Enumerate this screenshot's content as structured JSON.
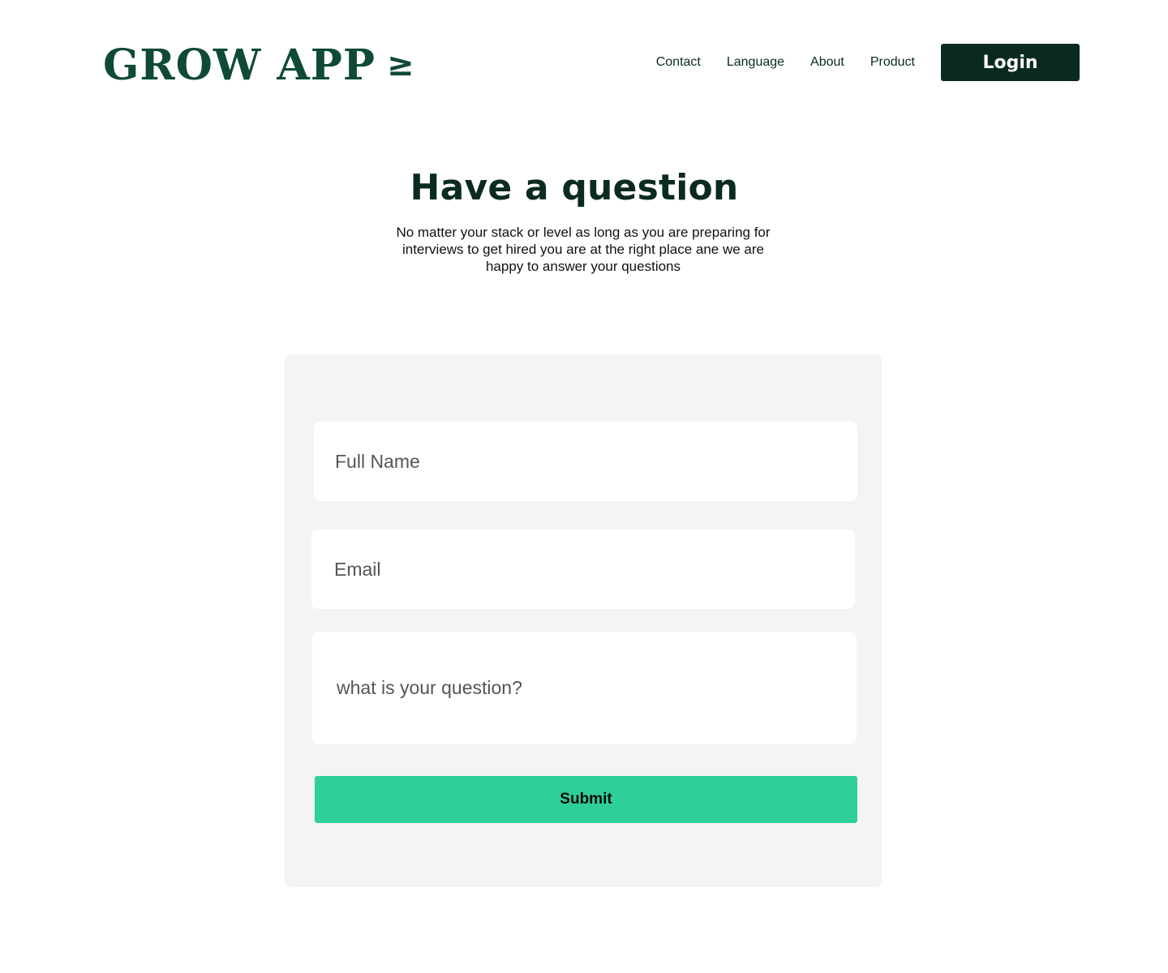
{
  "header": {
    "logo_text": "GROW APP",
    "logo_mark": "≥",
    "nav": [
      "Contact",
      "Language",
      "About",
      "Product"
    ],
    "login_label": "Login"
  },
  "hero": {
    "title": "Have a question",
    "subtitle": "No matter your stack or level as long as you are preparing for interviews to get hired you are at the right place ane we are happy to answer your questions"
  },
  "form": {
    "full_name_placeholder": "Full Name",
    "email_placeholder": "Email",
    "question_placeholder": "what is your question?",
    "submit_label": "Submit"
  },
  "colors": {
    "brand": "#0f4a36",
    "dark": "#0a2a1f",
    "accent": "#2ecf9a",
    "card_bg": "#f4f4f4"
  }
}
